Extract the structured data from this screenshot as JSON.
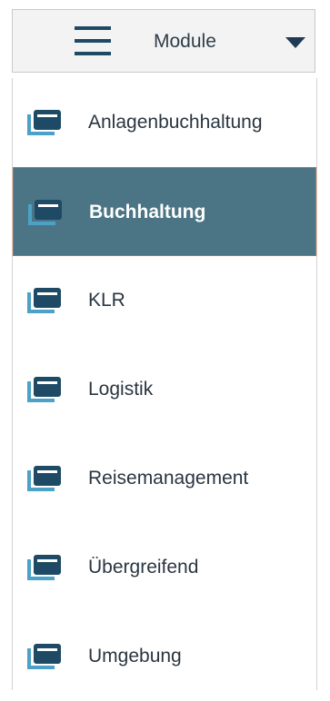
{
  "module_button": {
    "label": "Module",
    "icon": "hamburger-menu-icon",
    "caret_icon": "caret-down-icon"
  },
  "menu": {
    "item_icon": "window-stack-icon",
    "selected_index": 1,
    "items": [
      {
        "label": "Anlagenbuchhaltung",
        "selected": false
      },
      {
        "label": "Buchhaltung",
        "selected": true
      },
      {
        "label": "KLR",
        "selected": false
      },
      {
        "label": "Logistik",
        "selected": false
      },
      {
        "label": "Reisemanagement",
        "selected": false
      },
      {
        "label": "Übergreifend",
        "selected": false
      },
      {
        "label": "Umgebung",
        "selected": false
      }
    ]
  },
  "colors": {
    "icon_dark": "#1f4a66",
    "icon_light": "#4ba2c6",
    "selected_background": "#4b7585",
    "selected_border": "#c46a3f"
  }
}
